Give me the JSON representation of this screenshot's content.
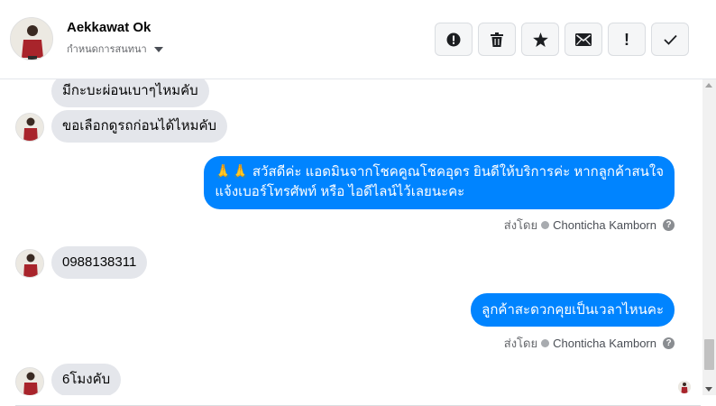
{
  "header": {
    "contact_name": "Aekkawat Ok",
    "assign_label": "กำหนดการสนทนา",
    "actions": [
      {
        "name": "report-spam-button",
        "icon": "alert-circle-icon"
      },
      {
        "name": "delete-button",
        "icon": "trash-icon"
      },
      {
        "name": "star-button",
        "icon": "star-icon"
      },
      {
        "name": "mark-unread-button",
        "icon": "envelope-icon"
      },
      {
        "name": "follow-up-button",
        "icon": "exclamation-icon",
        "glyph": "!"
      },
      {
        "name": "mark-done-button",
        "icon": "check-icon"
      }
    ]
  },
  "messages": {
    "m1": "มีกะบะผ่อนเบาๆไหมคับ",
    "m2": "ขอเลือกดูรถก่อนได้ไหมคับ",
    "m3_line1": "🙏🙏 สวัสดีค่ะ แอดมินจากโชคคูณโชคอุดร ยินดีให้บริการค่ะ หากลูกค้าสนใจ",
    "m3_line2": "แจ้งเบอร์โทรศัพท์ หรือ ไอดีไลน์ไว้เลยนะคะ",
    "m4": "0988138311",
    "m5": "ลูกค้าสะดวกคุยเป็นเวลาไหนคะ",
    "m6": "6โมงคับ"
  },
  "sent_by": {
    "prefix": "ส่งโดย",
    "agent": "Chonticha Kamborn",
    "help": "?"
  },
  "colors": {
    "outgoing_bubble": "#0084ff",
    "incoming_bubble": "#e4e6eb",
    "meta_text": "#65676b"
  }
}
